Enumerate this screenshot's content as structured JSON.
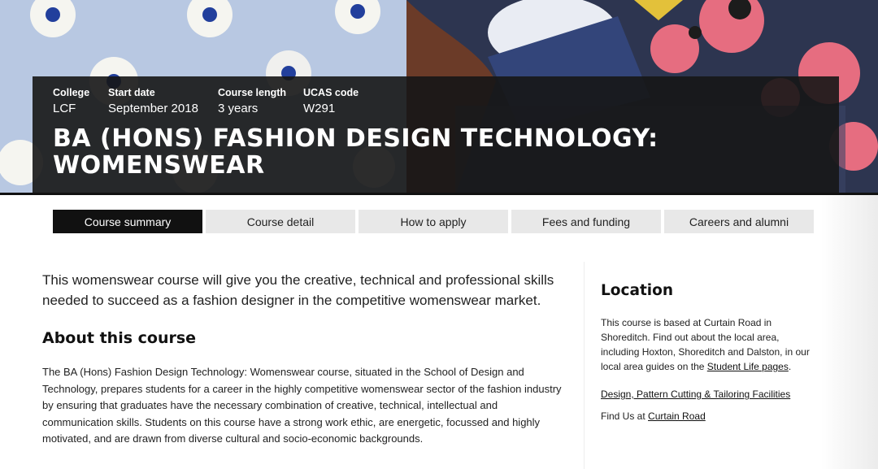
{
  "course_meta": [
    {
      "label": "College",
      "value": "LCF"
    },
    {
      "label": "Start date",
      "value": "September 2018"
    },
    {
      "label": "Course length",
      "value": "3 years"
    },
    {
      "label": "UCAS code",
      "value": "W291"
    }
  ],
  "course_title": "BA (HONS) FASHION DESIGN TECHNOLOGY: WOMENSWEAR",
  "tabs": [
    {
      "label": "Course summary",
      "active": true
    },
    {
      "label": "Course detail",
      "active": false
    },
    {
      "label": "How to apply",
      "active": false
    },
    {
      "label": "Fees and funding",
      "active": false
    },
    {
      "label": "Careers and alumni",
      "active": false
    }
  ],
  "main": {
    "intro": "This womenswear course will give you the creative, technical and professional skills needed to succeed as a fashion designer in the competitive womenswear market.",
    "about_heading": "About this course",
    "about_body": "The BA (Hons) Fashion Design Technology: Womenswear course, situated in the School of Design and Technology, prepares students for a career in the highly competitive womenswear sector of the fashion industry by ensuring that graduates have the necessary combination of creative, technical, intellectual and communication skills. Students on this course have a strong work ethic, are energetic, focussed and highly motivated, and are drawn from diverse cultural and socio-economic backgrounds."
  },
  "sidebar": {
    "heading": "Location",
    "text_before_link": "This course is based at Curtain Road in Shoreditch. Find out about the local area, including Hoxton, Shoreditch and Dalston, in our local area guides on the ",
    "student_life_link": "Student Life pages",
    "text_after_link": ".",
    "facilities_link": "Design, Pattern Cutting & Tailoring Facilities",
    "find_us_prefix": "Find Us at ",
    "find_us_link": "Curtain Road"
  },
  "colors": {
    "info_box": "#161616",
    "tab_active": "#111111",
    "tab_inactive": "#e8e8e8"
  }
}
